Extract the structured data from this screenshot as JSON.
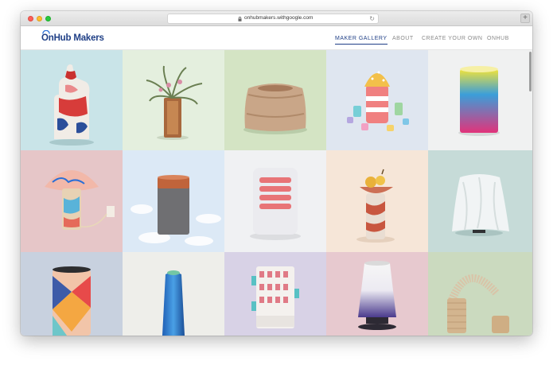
{
  "browser": {
    "url": "onhubmakers.withgoogle.com",
    "lock_icon": "lock-icon",
    "reload_icon": "reload-icon",
    "reload_glyph": "↻",
    "newtab_glyph": "+"
  },
  "site": {
    "logo_text": "OnHub Makers",
    "brand_color": "#1f3f86",
    "nav": [
      {
        "label": "MAKER GALLERY",
        "active": true
      },
      {
        "label": "ABOUT",
        "active": false
      },
      {
        "label": "CREATE YOUR OWN",
        "active": false
      },
      {
        "label": "ONHUB",
        "active": false
      }
    ]
  },
  "gallery": {
    "columns": 5,
    "rows": 3,
    "tiles": [
      {
        "subject": "hand-shaped-cover",
        "bg": "#c9e4e8"
      },
      {
        "subject": "air-plant-holder",
        "bg": "#e4efde"
      },
      {
        "subject": "fur-cover",
        "bg": "#d4e4c4"
      },
      {
        "subject": "paper-cupcake-village",
        "bg": "#dfe6f0"
      },
      {
        "subject": "gradient-cylinder",
        "bg": "#f0f1f1"
      },
      {
        "subject": "paint-splash-lamp",
        "bg": "#e6c6c8"
      },
      {
        "subject": "felt-cylinder-on-clouds",
        "bg": "#dce9f6"
      },
      {
        "subject": "red-accordion-cylinder",
        "bg": "#f0f1f3"
      },
      {
        "subject": "fruit-bowl-stand",
        "bg": "#f6e6d8"
      },
      {
        "subject": "cloth-draped-stand",
        "bg": "#c6dbd8"
      },
      {
        "subject": "geometric-paper-cylinder",
        "bg": "#c8d1df"
      },
      {
        "subject": "blue-tapered-cylinder",
        "bg": "#eeeeea"
      },
      {
        "subject": "building-facade-cylinder",
        "bg": "#d8d2e6"
      },
      {
        "subject": "purple-gradient-shade",
        "bg": "#e7c9cf"
      },
      {
        "subject": "slinky-spring",
        "bg": "#cbdabf"
      }
    ]
  }
}
